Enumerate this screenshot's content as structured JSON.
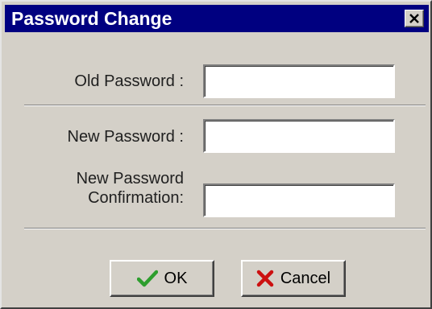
{
  "window": {
    "title": "Password Change"
  },
  "form": {
    "old_password_label": "Old Password :",
    "new_password_label": "New Password :",
    "confirm_label_line1": "New Password",
    "confirm_label_line2": "Confirmation:",
    "old_password_value": "",
    "new_password_value": "",
    "confirm_value": ""
  },
  "buttons": {
    "ok_label": "OK",
    "cancel_label": "Cancel"
  },
  "icons": {
    "ok": "checkmark-icon",
    "cancel": "x-icon",
    "close": "close-icon"
  },
  "colors": {
    "titlebar": "#000080",
    "check": "#2e9e2e",
    "cross": "#cc1010"
  }
}
